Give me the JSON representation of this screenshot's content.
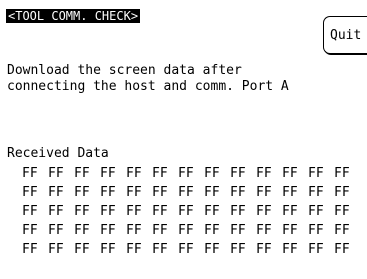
{
  "screen": {
    "title": "<TOOL COMM. CHECK>",
    "quit_label": "Quit",
    "message_line1": "Download the screen data after",
    "message_line2": "connecting the host and comm. Port A",
    "received_label": "Received Data",
    "received_data": [
      [
        "FF",
        "FF",
        "FF",
        "FF",
        "FF",
        "FF",
        "FF",
        "FF",
        "FF",
        "FF",
        "FF",
        "FF",
        "FF"
      ],
      [
        "FF",
        "FF",
        "FF",
        "FF",
        "FF",
        "FF",
        "FF",
        "FF",
        "FF",
        "FF",
        "FF",
        "FF",
        "FF"
      ],
      [
        "FF",
        "FF",
        "FF",
        "FF",
        "FF",
        "FF",
        "FF",
        "FF",
        "FF",
        "FF",
        "FF",
        "FF",
        "FF"
      ],
      [
        "FF",
        "FF",
        "FF",
        "FF",
        "FF",
        "FF",
        "FF",
        "FF",
        "FF",
        "FF",
        "FF",
        "FF",
        "FF"
      ],
      [
        "FF",
        "FF",
        "FF",
        "FF",
        "FF",
        "FF",
        "FF",
        "FF",
        "FF",
        "FF",
        "FF",
        "FF",
        "FF"
      ]
    ]
  }
}
